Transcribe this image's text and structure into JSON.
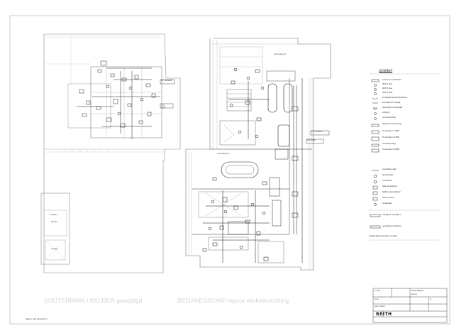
{
  "drawing": {
    "captions": {
      "basement": "SOUTERRAIN / KELDER gewijzigd",
      "ground_floor": "BEGANEGROND layout winkelinrichting"
    },
    "legend": {
      "title": "LEGENDA",
      "items": [
        "kanaal op wandsokkel",
        "WCD 1-fase",
        "WCD 3-fase",
        "WCD 3-fase",
        "schakelaar wandcontactdoos",
        "aansluitpunt voeding",
        "aansluitpunt schakelaar",
        "lichtpunt",
        "noodverlichting",
        "elektrische aansluiting",
        "TL-armatuur 1x36W",
        "TL-armatuur 2x36W",
        "noodverlichting",
        "TL-armatuur 1x58W",
        "aansluiting data",
        "brandmelder",
        "rookmelder",
        "data aansluitpunt",
        "telefoon aansluitpunt",
        "CCTV camera",
        "luidspreker"
      ],
      "notes": [
        "kabelgoot / wandgoot",
        "aansluiting verlichting",
        "hoogte opbouw kanalen en wcd's"
      ]
    },
    "room_labels": [
      "verdieping 1",
      "verdieping 0",
      "kelder",
      "ruimte 2",
      "opslag"
    ],
    "annotations": [
      "v.z. aansluit",
      "v.z. aansluit",
      "zie detail"
    ],
    "title_block": {
      "logo": "REITH",
      "project": "PLUS 000003",
      "sheet": "blad 1",
      "scale": "1:100",
      "drawing_no": "E-01",
      "date": "ged. datum",
      "rev": "A"
    },
    "footer_note": "datum: plot 2014-09-17"
  }
}
